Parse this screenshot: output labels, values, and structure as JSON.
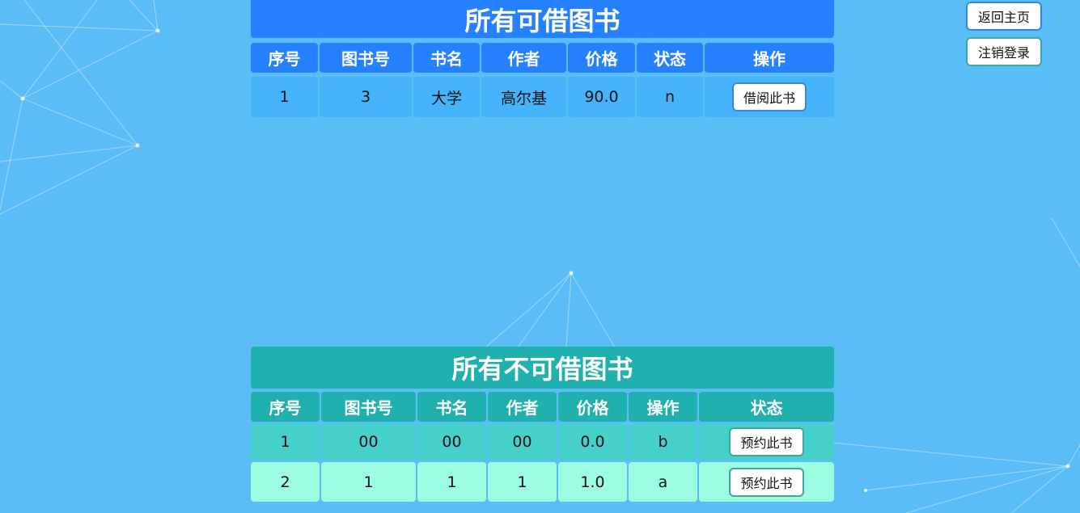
{
  "nav": {
    "home_label": "返回主页",
    "logout_label": "注销登录"
  },
  "borrowable": {
    "title": "所有可借图书",
    "headers": [
      "序号",
      "图书号",
      "书名",
      "作者",
      "价格",
      "状态",
      "操作"
    ],
    "rows": [
      {
        "index": "1",
        "book_no": "3",
        "name": "大学",
        "author": "高尔基",
        "price": "90.0",
        "status": "n",
        "action": "借阅此书"
      }
    ]
  },
  "unavailable": {
    "title": "所有不可借图书",
    "headers": [
      "序号",
      "图书号",
      "书名",
      "作者",
      "价格",
      "操作",
      "状态"
    ],
    "rows": [
      {
        "index": "1",
        "book_no": "00",
        "name": "00",
        "author": "00",
        "price": "0.0",
        "status": "b",
        "action": "预约此书"
      },
      {
        "index": "2",
        "book_no": "1",
        "name": "1",
        "author": "1",
        "price": "1.0",
        "status": "a",
        "action": "预约此书"
      }
    ]
  },
  "colors": {
    "background": "#5bbdf5",
    "borrowable_header": "#2581ff",
    "borrowable_row": "#46b4fb",
    "unavailable_header": "#20b0ae",
    "unavailable_row_1": "#46d0cc",
    "unavailable_row_2": "#9dfde0"
  }
}
